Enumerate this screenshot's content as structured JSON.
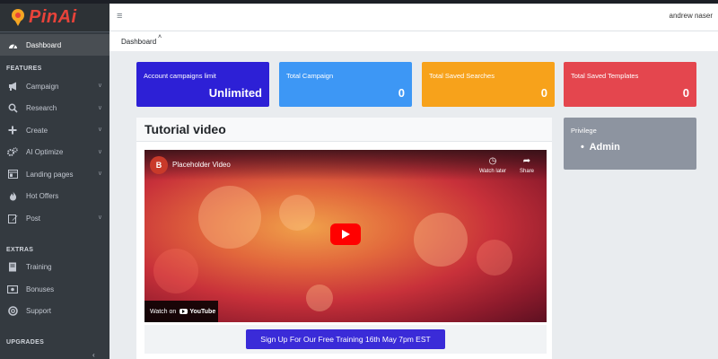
{
  "brand": {
    "name": "PinAi"
  },
  "topbar": {
    "username": "andrew naser"
  },
  "breadcrumb": {
    "label": "Dashboard"
  },
  "sidebar": {
    "dashboard": {
      "label": "Dashboard",
      "icon": "dashboard-icon"
    },
    "features_header": "FEATURES",
    "features": [
      {
        "label": "Campaign",
        "icon": "megaphone-icon",
        "has_chevron": true
      },
      {
        "label": "Research",
        "icon": "search-icon",
        "has_chevron": true
      },
      {
        "label": "Create",
        "icon": "plus-icon",
        "has_chevron": true
      },
      {
        "label": "AI Optimize",
        "icon": "gears-icon",
        "has_chevron": true
      },
      {
        "label": "Landing pages",
        "icon": "landing-page-icon",
        "has_chevron": true
      },
      {
        "label": "Hot Offers",
        "icon": "fire-icon",
        "has_chevron": false
      },
      {
        "label": "Post",
        "icon": "edit-icon",
        "has_chevron": true
      }
    ],
    "extras_header": "EXTRAS",
    "extras": [
      {
        "label": "Training",
        "icon": "book-icon"
      },
      {
        "label": "Bonuses",
        "icon": "money-icon"
      },
      {
        "label": "Support",
        "icon": "lifebuoy-icon"
      }
    ],
    "upgrades_header": "UPGRADES"
  },
  "cards": [
    {
      "title": "Account campaigns limit",
      "value": "Unlimited",
      "color": "#2d20d6"
    },
    {
      "title": "Total Campaign",
      "value": "0",
      "color": "#3d97f5"
    },
    {
      "title": "Total Saved Searches",
      "value": "0",
      "color": "#f7a21b"
    },
    {
      "title": "Total Saved Templates",
      "value": "0",
      "color": "#e4464e"
    }
  ],
  "tutorial": {
    "title": "Tutorial video",
    "video": {
      "channel_initial": "B",
      "title": "Placeholder Video",
      "watch_later": "Watch later",
      "share": "Share",
      "watch_on": "Watch on",
      "youtube": "YouTube"
    },
    "signup_button": "Sign Up For Our Free Training 16th May 7pm EST"
  },
  "privilege": {
    "title": "Privilege",
    "items": [
      "Admin"
    ]
  }
}
